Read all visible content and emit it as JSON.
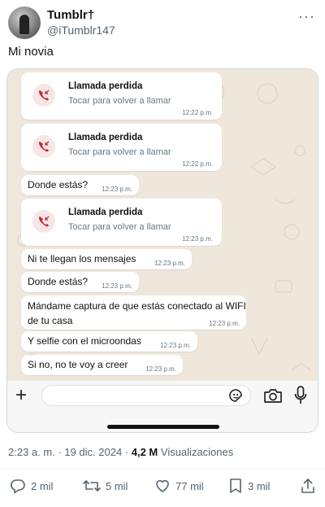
{
  "author": {
    "display_name": "Tumblr†",
    "handle": "@iTumblr147",
    "more_icon": "more-horizontal-icon"
  },
  "tweet": {
    "text": "Mi novia"
  },
  "chat": {
    "missed_calls": [
      {
        "title": "Llamada perdida",
        "subtitle": "Tocar para volver a llamar",
        "time": "12:22 p.m."
      },
      {
        "title": "Llamada perdida",
        "subtitle": "Tocar para volver a llamar",
        "time": "12:22 p.m."
      },
      {
        "title": "Llamada perdida",
        "subtitle": "Tocar para volver a llamar",
        "time": "12:23 p.m."
      }
    ],
    "messages": [
      {
        "text": "Donde estás?",
        "time": "12:23 p.m."
      },
      {
        "text": "Ni te llegan los mensajes",
        "time": "12:23 p.m."
      },
      {
        "text": "Donde estás?",
        "time": "12:23 p.m."
      },
      {
        "text": "Mándame captura de que estás conectado al WIFI de tu casa",
        "time": "12:23 p.m."
      },
      {
        "text": "Y selfie con el microondas",
        "time": "12:23 p.m."
      },
      {
        "text": "Si no, no te voy a creer",
        "time": "12:23 p.m."
      }
    ],
    "composer": {
      "plus": "+",
      "input_value": "",
      "icons": [
        "sticker-icon",
        "camera-icon",
        "microphone-icon"
      ]
    },
    "colors": {
      "background": "#efe7dc",
      "missed_call_red": "#c62a32"
    }
  },
  "meta": {
    "time_date": "2:23 a. m. · 19 dic. 2024 · ",
    "views_count": "4,2 M",
    "views_label": " Visualizaciones"
  },
  "actions": {
    "replies": "2 mil",
    "reposts": "5 mil",
    "likes": "77 mil",
    "bookmarks": "3 mil"
  }
}
